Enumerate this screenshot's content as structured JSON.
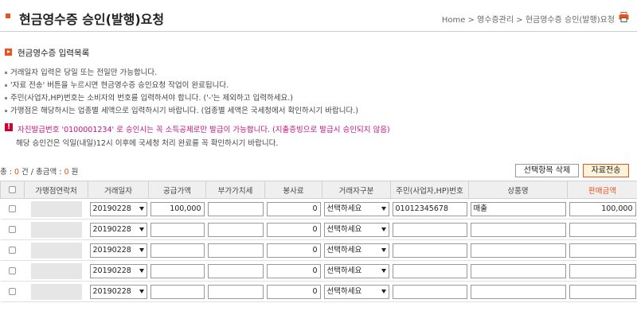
{
  "header": {
    "title": "현금영수증 승인(발행)요청",
    "breadcrumb": "Home > 영수증관리 > 현금영수증 승인(발행)요청",
    "print_icon": "printer-icon"
  },
  "section": {
    "label": "현금영수증 입력목록"
  },
  "notes": [
    "거래일자 입력은 당일 또는 전일만 가능합니다.",
    "'자료 전송' 버튼을 누르시면 현금영수증 승인요청 작업이 완료됩니다.",
    "주민(사업자,HP)번호는 소비자의 번호를 입력하셔야 합니다. ('-'는 제외하고 입력하세요.)",
    "가맹점은 해당하시는 업종별 세액으로 입력하시기 바랍니다. (업종별 세액은 국세청에서 확인하시기 바랍니다.)"
  ],
  "warning": {
    "icon": "!",
    "line1": "자진발급번호 '0100001234' 로 승인시는 꼭 소득공제로만 발급이 가능합니다. (지출증빙으로 발급시 승인되지 않음)",
    "line2": "해당 승인건은 익일(내일)12시 이후에 국세청 처리 완료를 꼭 확인하시기 바랍니다."
  },
  "totals": {
    "count_label": "총 : ",
    "count": "0",
    "count_unit": " 건 / 총금액 : ",
    "amount": "0",
    "amount_unit": " 원"
  },
  "buttons": {
    "delete": "선택항목 삭제",
    "send": "자료전송"
  },
  "table": {
    "headers": [
      "",
      "가맹점연락처",
      "거래일자",
      "공급가액",
      "부가가치세",
      "봉사료",
      "거래자구분",
      "주민(사업자,HP)번호",
      "상품명",
      "판매금액"
    ],
    "rows": [
      {
        "date": "20190228",
        "supply": "100,000",
        "vat": "",
        "service": "0",
        "type": "선택하세요",
        "id_number": "01012345678",
        "product": "매출",
        "sale": "100,000"
      },
      {
        "date": "20190228",
        "supply": "",
        "vat": "",
        "service": "0",
        "type": "선택하세요",
        "id_number": "",
        "product": "",
        "sale": ""
      },
      {
        "date": "20190228",
        "supply": "",
        "vat": "",
        "service": "0",
        "type": "선택하세요",
        "id_number": "",
        "product": "",
        "sale": ""
      },
      {
        "date": "20190228",
        "supply": "",
        "vat": "",
        "service": "0",
        "type": "선택하세요",
        "id_number": "",
        "product": "",
        "sale": ""
      },
      {
        "date": "20190228",
        "supply": "",
        "vat": "",
        "service": "0",
        "type": "선택하세요",
        "id_number": "",
        "product": "",
        "sale": ""
      }
    ]
  },
  "colors": {
    "accent": "#e8541e",
    "warning_text": "#c0137f"
  }
}
